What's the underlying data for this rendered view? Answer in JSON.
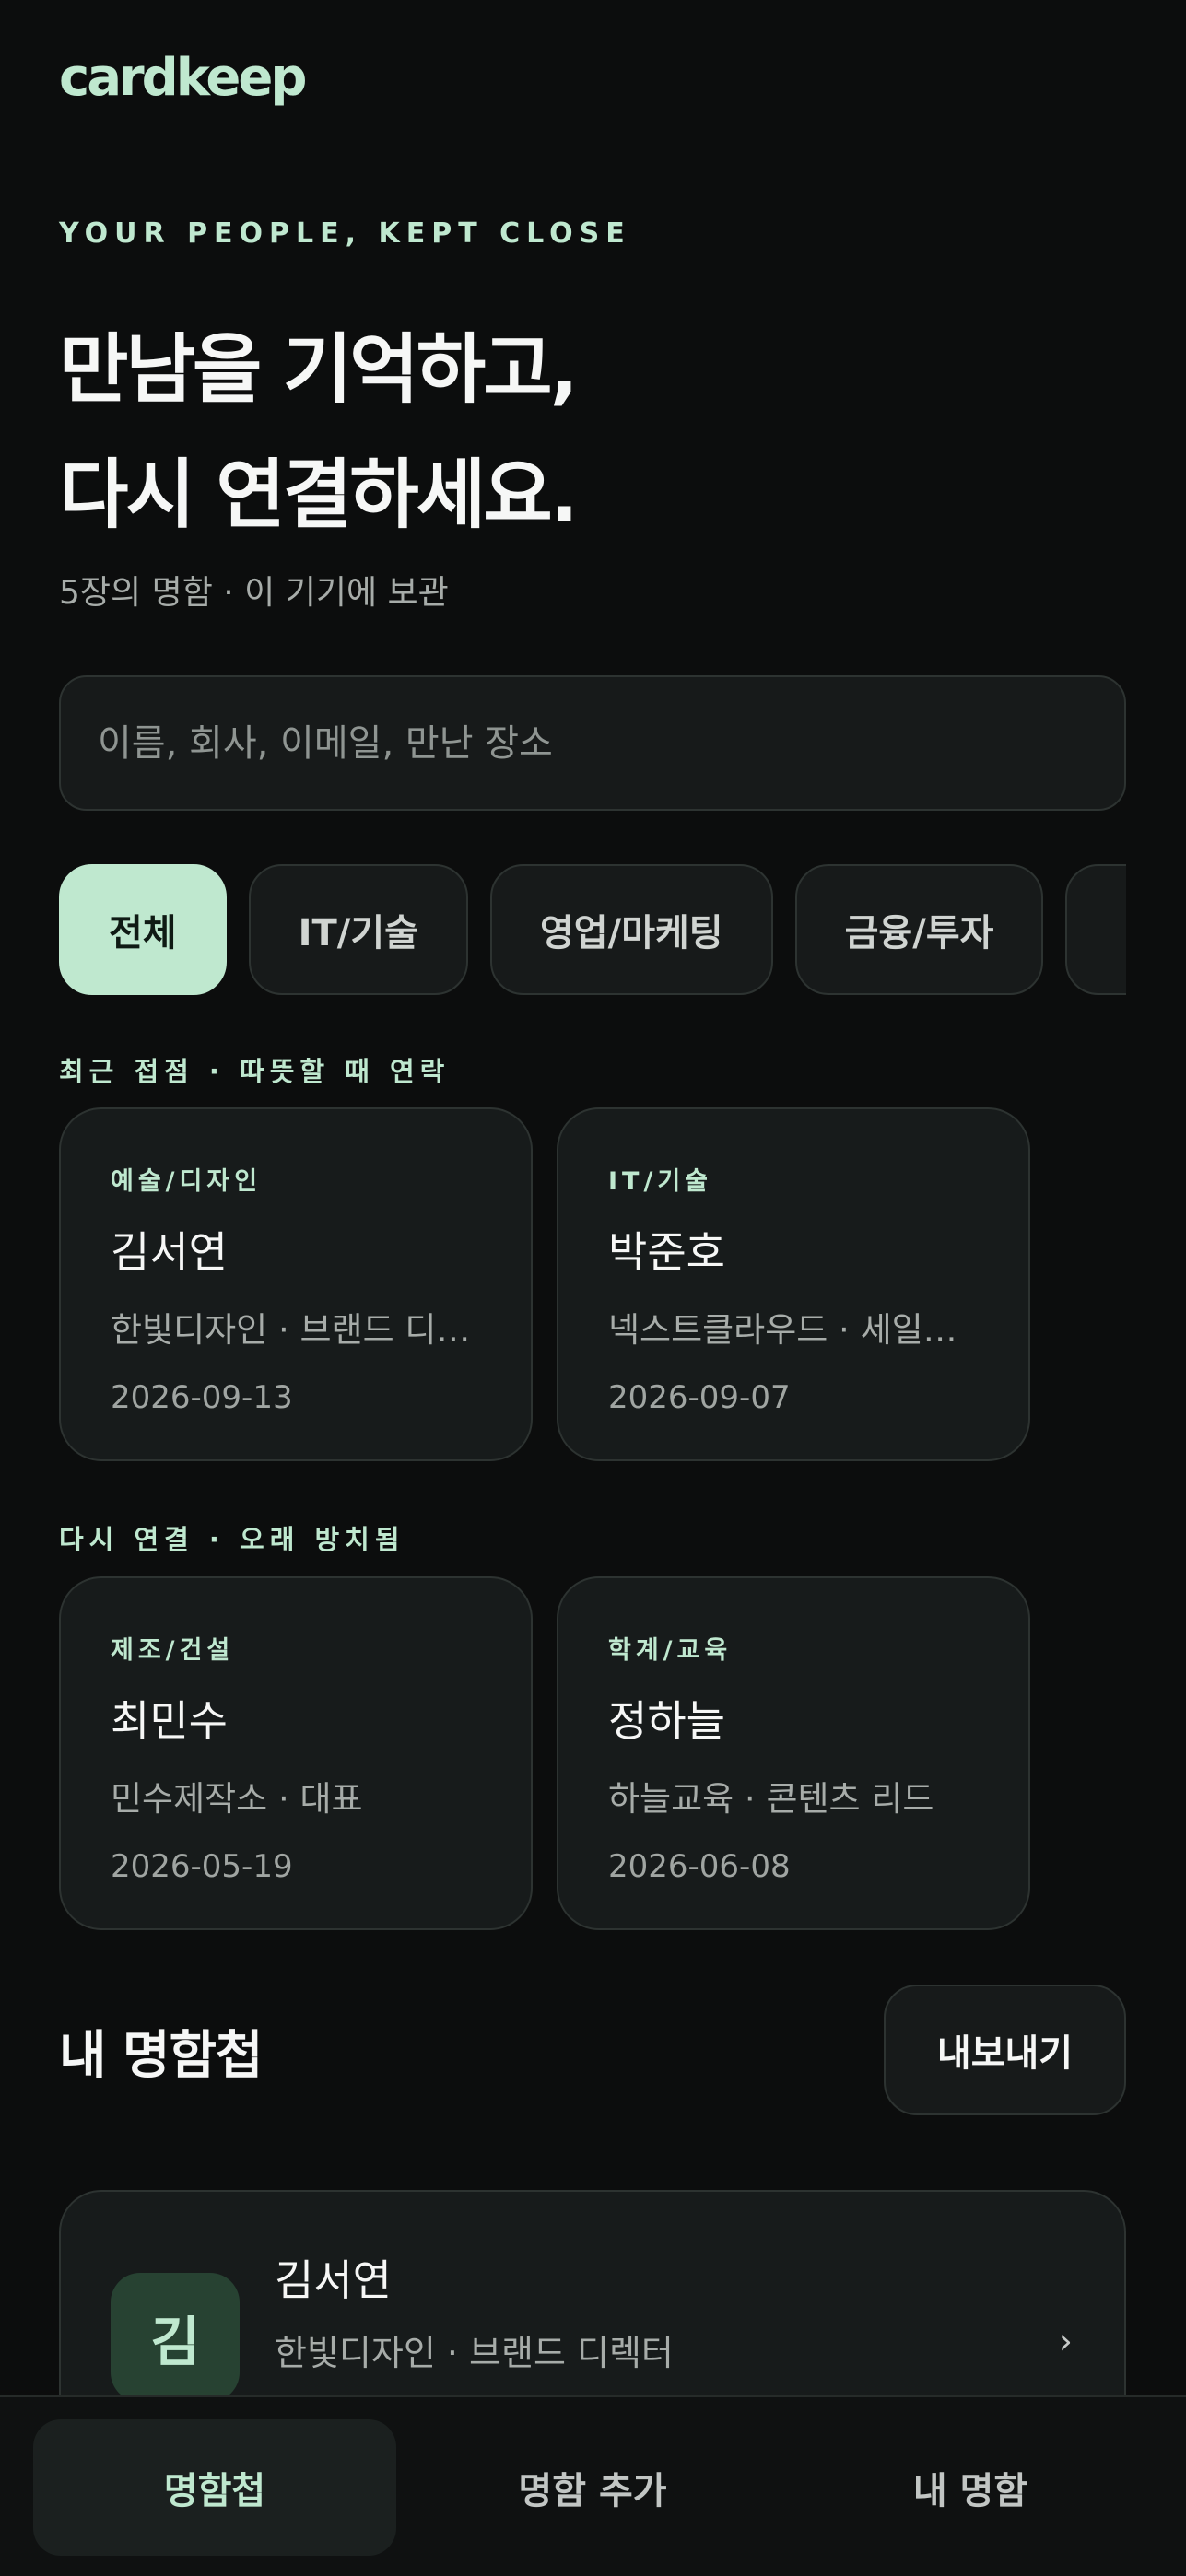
{
  "app": {
    "name": "cardkeep"
  },
  "hero": {
    "eyebrow": "YOUR PEOPLE, KEPT CLOSE",
    "headline_line1": "만남을 기억하고,",
    "headline_line2": "다시 연결하세요.",
    "subtitle": "5장의 명함 · 이 기기에 보관"
  },
  "search": {
    "placeholder": "이름, 회사, 이메일, 만난 장소",
    "value": ""
  },
  "filters": [
    {
      "label": "전체",
      "active": true
    },
    {
      "label": "IT/기술",
      "active": false
    },
    {
      "label": "영업/마케팅",
      "active": false
    },
    {
      "label": "금융/투자",
      "active": false
    },
    {
      "label": "",
      "active": false
    }
  ],
  "recent": {
    "label": "최근 접점 · 따뜻할 때 연락",
    "cards": [
      {
        "category": "예술/디자인",
        "name": "김서연",
        "org": "한빛디자인 · 브랜드 디렉터",
        "date": "2026-09-13"
      },
      {
        "category": "IT/기술",
        "name": "박준호",
        "org": "넥스트클라우드 · 세일즈 매니저",
        "date": "2026-09-07"
      }
    ]
  },
  "reconnect": {
    "label": "다시 연결 · 오래 방치됨",
    "cards": [
      {
        "category": "제조/건설",
        "name": "최민수",
        "org": "민수제작소 · 대표",
        "date": "2026-05-19"
      },
      {
        "category": "학계/교육",
        "name": "정하늘",
        "org": "하늘교육 · 콘텐츠 리드",
        "date": "2026-06-08"
      }
    ]
  },
  "cardbook": {
    "title": "내 명함첩",
    "export_label": "내보내기",
    "items": [
      {
        "initial": "김",
        "name": "김서연",
        "org": "한빛디자인 · 브랜드 디렉터",
        "chevron": "›"
      }
    ]
  },
  "nav": {
    "items": [
      {
        "label": "명함첩",
        "active": true
      },
      {
        "label": "명함 추가",
        "active": false
      },
      {
        "label": "내 명함",
        "active": false
      }
    ]
  },
  "colors": {
    "accent": "#bfe8cf",
    "background": "#0c0d0d",
    "surface": "#171b1b"
  }
}
